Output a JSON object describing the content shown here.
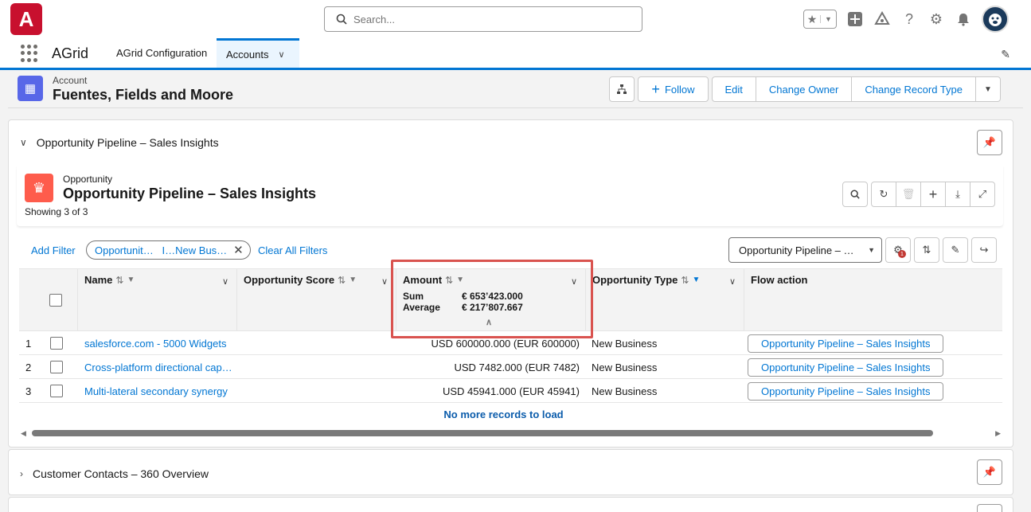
{
  "header": {
    "logo_text": "A",
    "search_placeholder": "Search...",
    "help_glyph": "?",
    "brand_color": "#c8102e"
  },
  "nav": {
    "app_name": "AGrid",
    "tabs": [
      {
        "label": "AGrid Configuration",
        "active": false
      },
      {
        "label": "Accounts",
        "active": true
      }
    ]
  },
  "record": {
    "type": "Account",
    "name": "Fuentes, Fields and Moore",
    "buttons": {
      "follow": "Follow",
      "edit": "Edit",
      "change_owner": "Change Owner",
      "change_record_type": "Change Record Type"
    }
  },
  "section": {
    "title": "Opportunity Pipeline – Sales Insights",
    "grid_object": "Opportunity",
    "grid_title": "Opportunity Pipeline – Sales Insights",
    "count": "Showing 3 of 3"
  },
  "filters": {
    "add_filter": "Add Filter",
    "pill_text": "Opportunit…   I…New Bus…",
    "clear_all": "Clear All Filters",
    "view": "Opportunity Pipeline – …",
    "badge_count": "1"
  },
  "table": {
    "columns": {
      "name": "Name",
      "score": "Opportunity Score",
      "amount": "Amount",
      "type": "Opportunity Type",
      "flow": "Flow action"
    },
    "aggregates": {
      "sum_label": "Sum",
      "sum_value": "€ 653’423.000",
      "avg_label": "Average",
      "avg_value": "€ 217’807.667"
    },
    "rows": [
      {
        "num": "1",
        "name": "salesforce.com - 5000 Widgets",
        "amount": "USD 600000.000 (EUR 600000)",
        "type": "New Business",
        "flow": "Opportunity Pipeline – Sales Insights"
      },
      {
        "num": "2",
        "name": "Cross-platform directional cap…",
        "amount": "USD 7482.000 (EUR 7482)",
        "type": "New Business",
        "flow": "Opportunity Pipeline – Sales Insights"
      },
      {
        "num": "3",
        "name": "Multi-lateral secondary synergy",
        "amount": "USD 45941.000 (EUR 45941)",
        "type": "New Business",
        "flow": "Opportunity Pipeline – Sales Insights"
      }
    ],
    "no_more": "No more records to load"
  },
  "section2": {
    "title": "Customer Contacts – 360 Overview"
  }
}
